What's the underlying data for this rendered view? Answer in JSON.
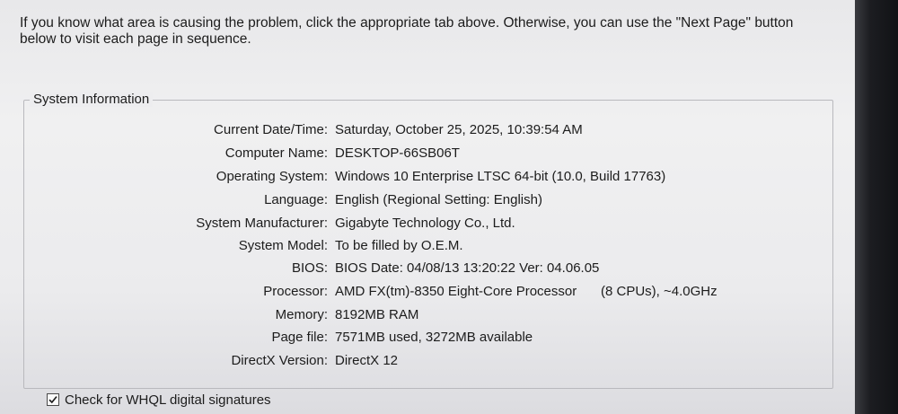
{
  "intro_text": "If you know what area is causing the problem, click the appropriate tab above.  Otherwise, you can use the \"Next Page\" button below to visit each page in sequence.",
  "group_title": "System Information",
  "rows": [
    {
      "label": "Current Date/Time:",
      "value": "Saturday, October 25, 2025, 10:39:54 AM"
    },
    {
      "label": "Computer Name:",
      "value": "DESKTOP-66SB06T"
    },
    {
      "label": "Operating System:",
      "value": "Windows 10 Enterprise LTSC 64-bit (10.0, Build 17763)"
    },
    {
      "label": "Language:",
      "value": "English (Regional Setting: English)"
    },
    {
      "label": "System Manufacturer:",
      "value": "Gigabyte Technology Co., Ltd."
    },
    {
      "label": "System Model:",
      "value": "To be filled by O.E.M."
    },
    {
      "label": "BIOS:",
      "value": "BIOS Date: 04/08/13 13:20:22 Ver: 04.06.05"
    },
    {
      "label": "Processor:",
      "value": "AMD FX(tm)-8350 Eight-Core Processor",
      "extra": "(8 CPUs), ~4.0GHz"
    },
    {
      "label": "Memory:",
      "value": "8192MB RAM"
    },
    {
      "label": "Page file:",
      "value": "7571MB used, 3272MB available"
    },
    {
      "label": "DirectX Version:",
      "value": "DirectX 12"
    }
  ],
  "whql": {
    "label": "Check for WHQL digital signatures",
    "checked": true
  }
}
